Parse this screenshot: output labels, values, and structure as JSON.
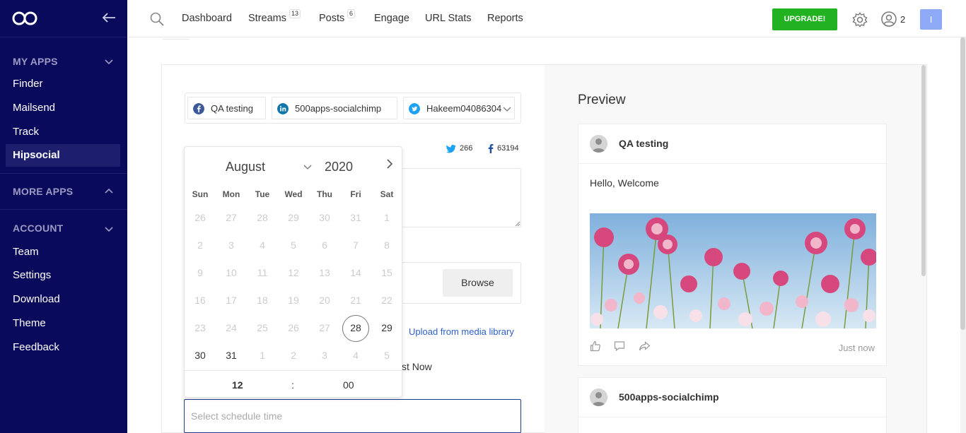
{
  "sidebar": {
    "sections": {
      "my_apps": "MY APPS",
      "more_apps": "MORE APPS",
      "account": "ACCOUNT"
    },
    "my_apps_items": [
      "Finder",
      "Mailsend",
      "Track",
      "Hipsocial"
    ],
    "account_items": [
      "Team",
      "Settings",
      "Download",
      "Theme",
      "Feedback"
    ],
    "active_item": "Hipsocial"
  },
  "nav": {
    "items": [
      {
        "label": "Dashboard"
      },
      {
        "label": "Streams",
        "badge": "13"
      },
      {
        "label": "Posts",
        "badge": "6"
      },
      {
        "label": "Engage"
      },
      {
        "label": "URL Stats"
      },
      {
        "label": "Reports"
      }
    ],
    "upgrade_label": "UPGRADE!",
    "user_count": "2",
    "avatar_initial": "I"
  },
  "composer": {
    "accounts": [
      {
        "label": "QA testing",
        "network": "facebook"
      },
      {
        "label": "500apps-socialchimp",
        "network": "linkedin"
      },
      {
        "label": "Hakeem04086304",
        "network": "twitter"
      }
    ],
    "twitter_count": "266",
    "facebook_count": "63194",
    "browse_label": "Browse",
    "media_link": "Upload from media library",
    "post_now_partial": "st Now",
    "schedule_placeholder": "Select schedule time"
  },
  "calendar": {
    "month": "August",
    "year": "2020",
    "weekdays": [
      "Sun",
      "Mon",
      "Tue",
      "Wed",
      "Thu",
      "Fri",
      "Sat"
    ],
    "weeks": [
      [
        "26",
        "27",
        "28",
        "29",
        "30",
        "31",
        "1"
      ],
      [
        "2",
        "3",
        "4",
        "5",
        "6",
        "7",
        "8"
      ],
      [
        "9",
        "10",
        "11",
        "12",
        "13",
        "14",
        "15"
      ],
      [
        "16",
        "17",
        "18",
        "19",
        "20",
        "21",
        "22"
      ],
      [
        "23",
        "24",
        "25",
        "26",
        "27",
        "28",
        "29"
      ],
      [
        "30",
        "31",
        "1",
        "2",
        "3",
        "4",
        "5"
      ]
    ],
    "today": "28",
    "hour": "12",
    "separator": ":",
    "minute": "00"
  },
  "preview": {
    "title": "Preview",
    "cards": [
      {
        "name": "QA testing",
        "text": "Hello, Welcome",
        "time": "Just now"
      },
      {
        "name": "500apps-socialchimp"
      }
    ]
  },
  "colors": {
    "sidebar_bg": "#0a0a5c",
    "upgrade_bg": "#21b121",
    "link": "#2d5fcf",
    "avatar_bg": "#8ea9f5"
  }
}
